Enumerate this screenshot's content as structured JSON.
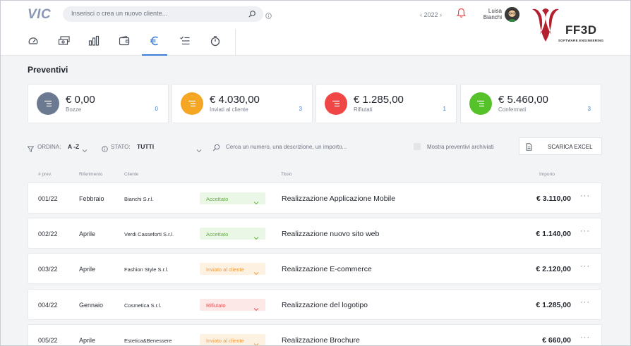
{
  "header": {
    "logo": "VIC",
    "search_placeholder": "Inserisci o crea un nuovo cliente...",
    "year": "2022",
    "user_first": "Luisa",
    "user_last": "Bianchi",
    "brand_name": "FF3D",
    "brand_sub": "SOFTWARE ENGINEERING"
  },
  "nav": {
    "icons": [
      "dashboard-icon",
      "cash-icon",
      "bar-chart-icon",
      "wallet-icon",
      "euro-icon",
      "checklist-icon",
      "timer-icon"
    ],
    "active": "euro-icon"
  },
  "page": {
    "title": "Preventivi"
  },
  "cards": [
    {
      "amount": "€ 0,00",
      "label": "Bozze",
      "count": "0",
      "color": "#6b7a90"
    },
    {
      "amount": "€ 4.030,00",
      "label": "Inviati al cliente",
      "count": "3",
      "color": "#f5a623"
    },
    {
      "amount": "€ 1.285,00",
      "label": "Rifiutati",
      "count": "1",
      "color": "#f04646"
    },
    {
      "amount": "€ 5.460,00",
      "label": "Confermati",
      "count": "3",
      "color": "#56c22a"
    }
  ],
  "filters": {
    "order_label": "ORDINA:",
    "order_value": "A -Z",
    "state_label": "STATO:",
    "state_value": "TUTTI",
    "search_placeholder": "Cerca un numero, una descrizione, un importo...",
    "archived_label": "Mostra preventivi archiviati",
    "export_label": "SCARICA EXCEL"
  },
  "table": {
    "headers": {
      "num": "# prev.",
      "ref": "Riferimento",
      "client": "Cliente",
      "title": "Titolo",
      "amount": "Importo"
    },
    "rows": [
      {
        "num": "001/22",
        "ref": "Febbraio",
        "client": "Bianchi S.r.l.",
        "status": "Accettato",
        "status_type": "accepted",
        "title": "Realizzazione Applicazione Mobile",
        "amount": "€ 3.110,00"
      },
      {
        "num": "002/22",
        "ref": "Aprile",
        "client": "Verdi Casseforti S.r.l.",
        "status": "Accettato",
        "status_type": "accepted",
        "title": "Realizzazione nuovo sito web",
        "amount": "€ 1.140,00"
      },
      {
        "num": "003/22",
        "ref": "Aprile",
        "client": "Fashion Style S.r.l.",
        "status": "Inviato al cliente",
        "status_type": "sent",
        "title": "Realizzazione E-commerce",
        "amount": "€ 2.120,00"
      },
      {
        "num": "004/22",
        "ref": "Gennaio",
        "client": "Cosmetica S.r.l.",
        "status": "Rifiutato",
        "status_type": "rejected",
        "title": "Realizzazione del logotipo",
        "amount": "€ 1.285,00"
      },
      {
        "num": "005/22",
        "ref": "Aprile",
        "client": "Estetica&Benessere",
        "status": "Inviato al cliente",
        "status_type": "sent",
        "title": "Realizzazione Brochure",
        "amount": "€ 660,00"
      }
    ]
  },
  "status_colors": {
    "accepted": {
      "bg": "#eaf7e6",
      "fg": "#5cb33a"
    },
    "sent": {
      "bg": "#fdf1e2",
      "fg": "#f0993a"
    },
    "rejected": {
      "bg": "#fde8e8",
      "fg": "#ea4b4b"
    }
  }
}
